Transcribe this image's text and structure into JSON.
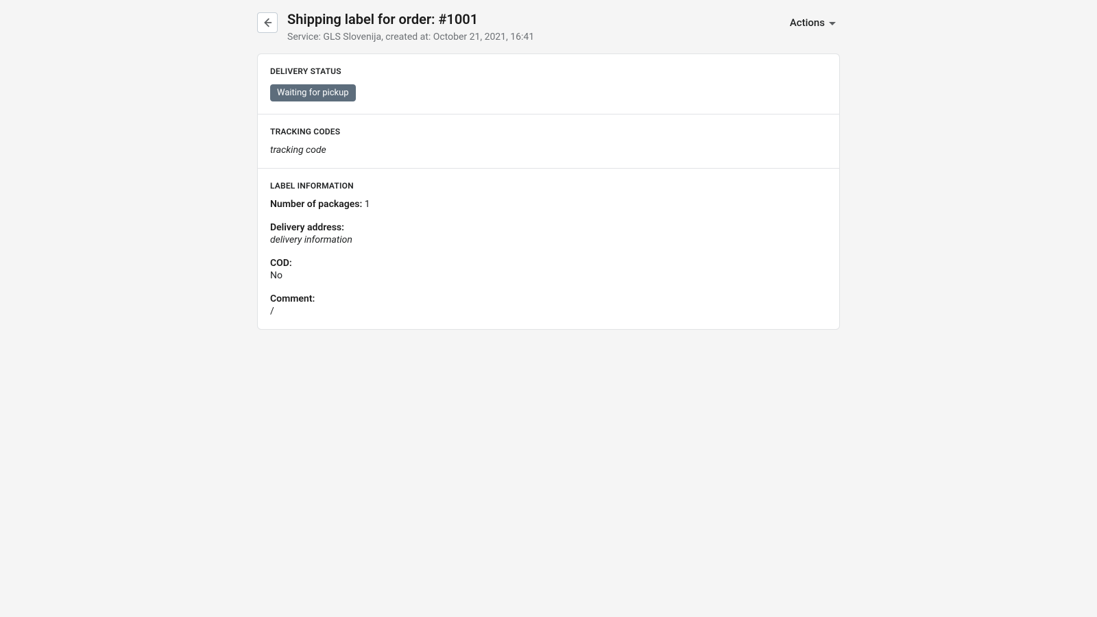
{
  "header": {
    "title": "Shipping label for order: #1001",
    "subtitle": "Service: GLS Slovenija, created at: October 21, 2021, 16:41",
    "actions_label": "Actions"
  },
  "delivery_status": {
    "heading": "DELIVERY STATUS",
    "badge": "Waiting for pickup"
  },
  "tracking_codes": {
    "heading": "TRACKING CODES",
    "code": "tracking code"
  },
  "label_info": {
    "heading": "LABEL INFORMATION",
    "num_packages_label": "Number of packages:",
    "num_packages_value": "1",
    "delivery_address_label": "Delivery address:",
    "delivery_address_value": "delivery information",
    "cod_label": "COD:",
    "cod_value": "No",
    "comment_label": "Comment:",
    "comment_value": "/"
  }
}
